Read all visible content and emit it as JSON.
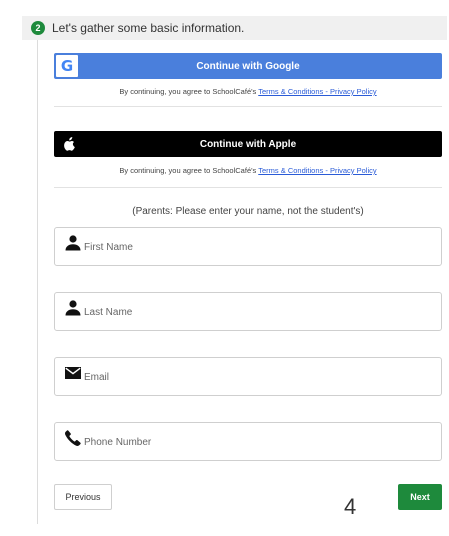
{
  "step": {
    "number": "2",
    "text": "Let's gather some basic information."
  },
  "google": {
    "icon": "google-g-icon",
    "label": "Continue with Google",
    "consent_prefix": "By continuing, you agree to SchoolCafé's",
    "consent_link": "Terms & Conditions - Privacy Policy"
  },
  "apple": {
    "icon": "apple-logo-icon",
    "label": "Continue with Apple",
    "consent_prefix": "By continuing, you agree to SchoolCafé's",
    "consent_link": "Terms & Conditions - Privacy Policy"
  },
  "parents_note": "(Parents: Please enter your name, not the student's)",
  "fields": {
    "first_name": {
      "icon": "person-icon",
      "placeholder": "First Name",
      "value": ""
    },
    "last_name": {
      "icon": "person-icon",
      "placeholder": "Last Name",
      "value": ""
    },
    "email": {
      "icon": "envelope-icon",
      "placeholder": "Email",
      "value": ""
    },
    "phone": {
      "icon": "phone-icon",
      "placeholder": "Phone Number",
      "value": ""
    }
  },
  "buttons": {
    "previous": "Previous",
    "next": "Next"
  },
  "page_number": "4",
  "colors": {
    "accent_green": "#1e8a3c",
    "google_blue": "#4a7fdc",
    "apple_black": "#000000",
    "link_blue": "#2a5bd7"
  }
}
